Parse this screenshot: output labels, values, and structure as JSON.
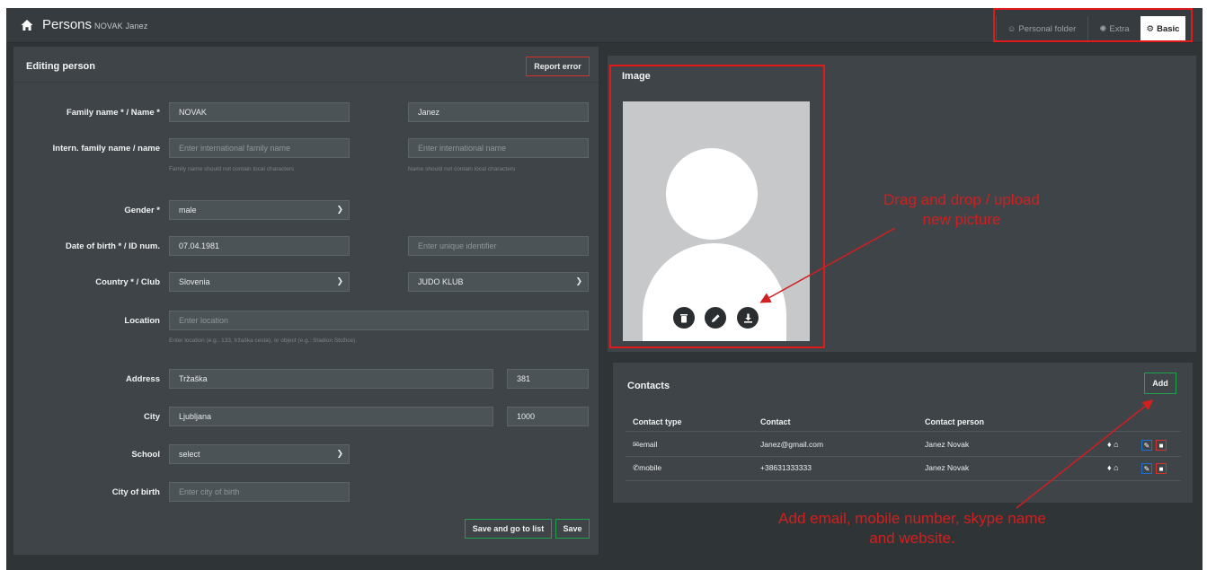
{
  "header": {
    "title": "Persons",
    "subtitle": "NOVAK Janez",
    "tabs": [
      {
        "label": "Personal folder",
        "icon": "user-lock-icon"
      },
      {
        "label": "Extra",
        "icon": "wrench-icon"
      },
      {
        "label": "Basic",
        "icon": "gear-icon"
      }
    ]
  },
  "edit": {
    "title": "Editing person",
    "report_error": "Report error",
    "labels": {
      "name": "Family name * / Name *",
      "intern": "Intern. family name / name",
      "gender": "Gender *",
      "dob": "Date of birth * / ID num.",
      "country": "Country * / Club",
      "location": "Location",
      "address": "Address",
      "city": "City",
      "school": "School",
      "city_birth": "City of birth"
    },
    "values": {
      "family_name": "NOVAK",
      "name": "Janez",
      "gender": "male",
      "dob": "07.04.1981",
      "country": "Slovenia",
      "club": "JUDO KLUB",
      "address": "Tržaška",
      "address_no": "381",
      "city": "Ljubljana",
      "postal": "1000",
      "school": "select"
    },
    "placeholders": {
      "intern_family": "Enter international family name",
      "intern_name": "Enter international name",
      "id": "Enter unique identifier",
      "location": "Enter location",
      "city_birth": "Enter city of birth"
    },
    "hints": {
      "intern_family": "Family name should not contain local characters",
      "intern_name": "Name should not contain local characters",
      "location": "Enter location (e.g.: 133, tržaška cesta), or object (e.g.: Stadion Stožice)."
    },
    "save_list": "Save and go to list",
    "save": "Save"
  },
  "image": {
    "title": "Image",
    "buttons": [
      "trash-icon",
      "pencil-icon",
      "download-icon"
    ]
  },
  "annotations": {
    "upload": "Drag and drop / upload\nnew picture",
    "contacts": "Add email, mobile number, skype name\nand website."
  },
  "contacts": {
    "title": "Contacts",
    "add": "Add",
    "columns": [
      "Contact type",
      "Contact",
      "Contact person"
    ],
    "rows": [
      {
        "type": "email",
        "icon": "envelope-icon",
        "contact": "Janez@gmail.com",
        "person": "Janez Novak"
      },
      {
        "type": "mobile",
        "icon": "phone-icon",
        "contact": "+38631333333",
        "person": "Janez Novak"
      }
    ]
  },
  "colors": {
    "annotation": "#d21f1f",
    "save_border": "#1fa34a",
    "report_border": "#d9302a"
  }
}
